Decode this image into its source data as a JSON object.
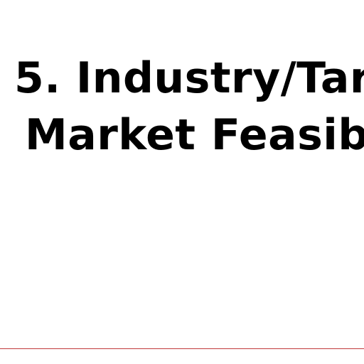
{
  "slide": {
    "title_line_1": "5. Industry/Tar",
    "title_line_2": "Market Feasibi"
  },
  "colors": {
    "background": "#ffffff",
    "title_text": "#000000",
    "footer_rule": "#c0393b"
  }
}
